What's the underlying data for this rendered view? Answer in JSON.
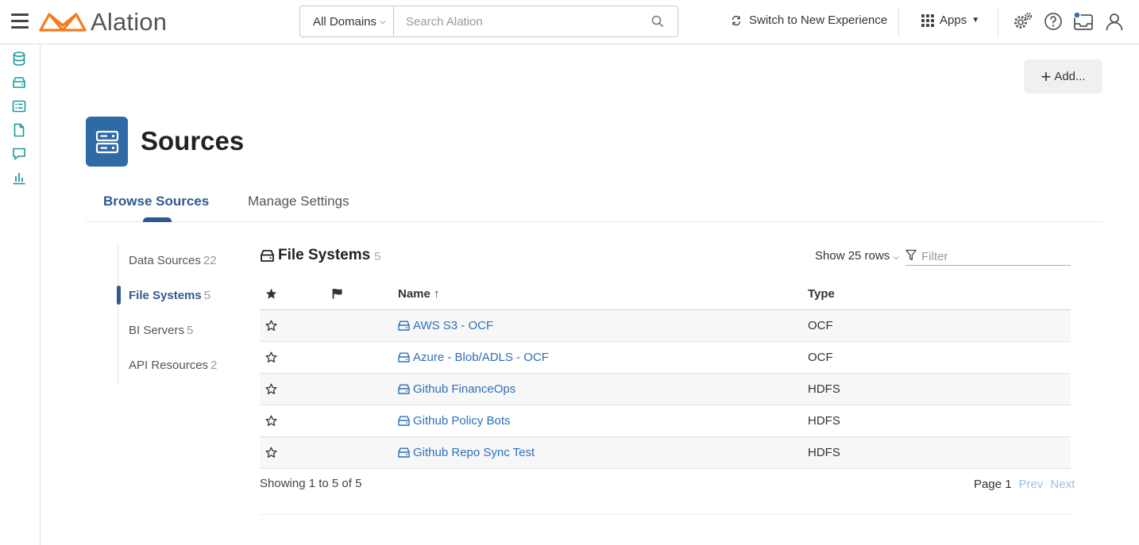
{
  "header": {
    "app_name": "Alation",
    "domain_select": "All Domains",
    "search_placeholder": "Search Alation",
    "switch_label": "Switch to New Experience",
    "apps_label": "Apps"
  },
  "left_rail": {
    "icons": [
      "database-icon",
      "file-system-icon",
      "bi-server-icon",
      "document-icon",
      "conversation-icon",
      "analytics-icon"
    ]
  },
  "toolbar": {
    "add_label": "Add..."
  },
  "page": {
    "title": "Sources"
  },
  "tabs": [
    {
      "label": "Browse Sources",
      "active": true
    },
    {
      "label": "Manage Settings",
      "active": false
    }
  ],
  "subnav": [
    {
      "label": "Data Sources",
      "count": "22",
      "active": false
    },
    {
      "label": "File Systems",
      "count": "5",
      "active": true
    },
    {
      "label": "BI Servers",
      "count": "5",
      "active": false
    },
    {
      "label": "API Resources",
      "count": "2",
      "active": false
    }
  ],
  "content": {
    "title": "File Systems",
    "count": "5",
    "show_rows": "Show 25 rows",
    "filter_placeholder": "Filter"
  },
  "table": {
    "columns": {
      "name": "Name",
      "type": "Type"
    },
    "rows": [
      {
        "name": "AWS S3 - OCF",
        "type": "OCF"
      },
      {
        "name": "Azure - Blob/ADLS - OCF",
        "type": "OCF"
      },
      {
        "name": "Github FinanceOps",
        "type": "HDFS"
      },
      {
        "name": "Github Policy Bots",
        "type": "HDFS"
      },
      {
        "name": "Github Repo Sync Test",
        "type": "HDFS"
      }
    ]
  },
  "footer": {
    "showing": "Showing 1 to 5 of 5",
    "page": "Page 1",
    "prev": "Prev",
    "next": "Next"
  },
  "colors": {
    "accent": "#2e5a8f",
    "link": "#2e6fb7",
    "rail_icon": "#1a9a9a",
    "logo_orange": "#f47b20"
  }
}
